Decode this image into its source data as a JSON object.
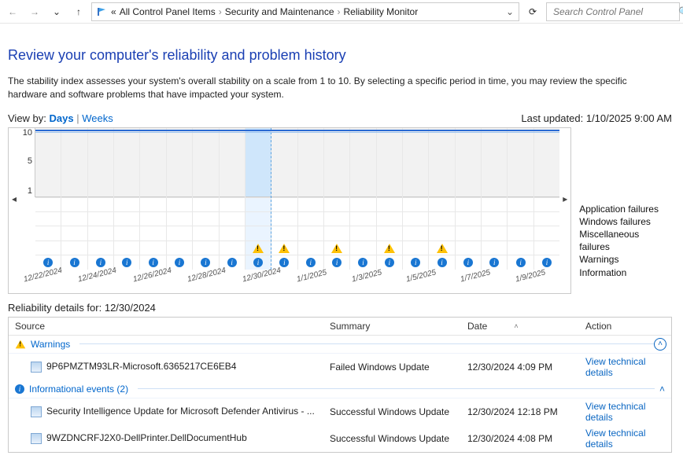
{
  "nav": {
    "crumbs_prefix": "«",
    "crumbs": [
      "All Control Panel Items",
      "Security and Maintenance",
      "Reliability Monitor"
    ],
    "search_placeholder": "Search Control Panel"
  },
  "title": "Review your computer's reliability and problem history",
  "description": "The stability index assesses your system's overall stability on a scale from 1 to 10. By selecting a specific period in time, you may review the specific hardware and software problems that have impacted your system.",
  "view": {
    "label": "View by:",
    "days": "Days",
    "sep": "|",
    "weeks": "Weeks"
  },
  "last_updated_label": "Last updated:",
  "last_updated_value": "1/10/2025 9:00 AM",
  "chart_data": {
    "type": "reliability-timeline",
    "y_ticks": [
      10,
      5,
      1
    ],
    "selected_index": 8,
    "x_labels": [
      "12/22/2024",
      "12/24/2024",
      "12/26/2024",
      "12/28/2024",
      "12/30/2024",
      "1/1/2025",
      "1/3/2025",
      "1/5/2025",
      "1/7/2025",
      "1/9/2025"
    ],
    "row_legend": [
      "Application failures",
      "Windows failures",
      "Miscellaneous failures",
      "Warnings",
      "Information"
    ],
    "days": [
      {
        "warn": false,
        "info": true
      },
      {
        "warn": false,
        "info": true
      },
      {
        "warn": false,
        "info": true
      },
      {
        "warn": false,
        "info": true
      },
      {
        "warn": false,
        "info": true
      },
      {
        "warn": false,
        "info": true
      },
      {
        "warn": false,
        "info": true
      },
      {
        "warn": false,
        "info": true
      },
      {
        "warn": true,
        "info": true
      },
      {
        "warn": true,
        "info": true
      },
      {
        "warn": false,
        "info": true
      },
      {
        "warn": true,
        "info": true
      },
      {
        "warn": false,
        "info": true
      },
      {
        "warn": true,
        "info": true
      },
      {
        "warn": false,
        "info": true
      },
      {
        "warn": true,
        "info": true
      },
      {
        "warn": false,
        "info": true
      },
      {
        "warn": false,
        "info": true
      },
      {
        "warn": false,
        "info": true
      },
      {
        "warn": false,
        "info": true
      }
    ]
  },
  "details": {
    "title_prefix": "Reliability details for:",
    "title_date": "12/30/2024",
    "columns": {
      "source": "Source",
      "summary": "Summary",
      "date": "Date",
      "action": "Action"
    },
    "groups": [
      {
        "kind": "warnings",
        "label": "Warnings",
        "items": [
          {
            "source": "9P6PMZTM93LR-Microsoft.6365217CE6EB4",
            "summary": "Failed Windows Update",
            "date": "12/30/2024 4:09 PM",
            "action": "View technical details"
          }
        ]
      },
      {
        "kind": "info",
        "label": "Informational events (2)",
        "items": [
          {
            "source": "Security Intelligence Update for Microsoft Defender Antivirus - ...",
            "summary": "Successful Windows Update",
            "date": "12/30/2024 12:18 PM",
            "action": "View technical details"
          },
          {
            "source": "9WZDNCRFJ2X0-DellPrinter.DellDocumentHub",
            "summary": "Successful Windows Update",
            "date": "12/30/2024 4:08 PM",
            "action": "View technical details"
          }
        ]
      }
    ]
  }
}
